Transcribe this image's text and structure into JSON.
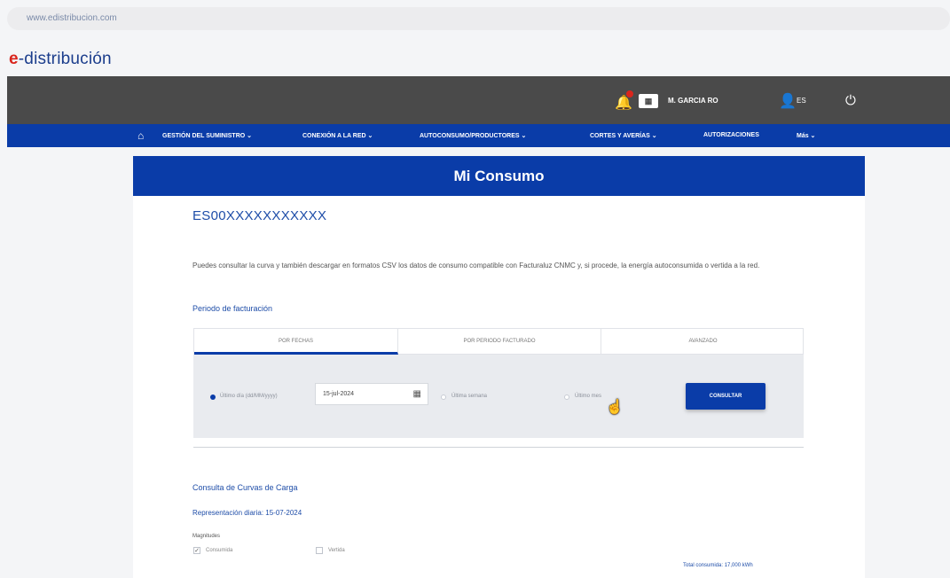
{
  "browser": {
    "url": "www.edistribucion.com"
  },
  "logo": {
    "prefix": "e",
    "text": "-distribución"
  },
  "topbar": {
    "user_name": "M. GARCIA RO",
    "lang": "ES",
    "icons": [
      "bell-icon",
      "id-card-icon",
      "person-icon",
      "power-icon"
    ]
  },
  "nav": {
    "items": [
      "GESTIÓN DEL SUMINISTRO ⌄",
      "CONEXIÓN A LA RED ⌄",
      "AUTOCONSUMO/PRODUCTORES ⌄",
      "CORTES Y AVERÍAS ⌄",
      "AUTORIZACIONES",
      "Más ⌄"
    ]
  },
  "page": {
    "title": "Mi Consumo",
    "cups": "ES00XXXXXXXXXXX",
    "description": "Puedes consultar la curva y también descargar en formatos CSV los datos de consumo compatible con Facturaluz CNMC y, si procede, la energía autoconsumida o vertida a la red.",
    "period_label": "Periodo de facturación"
  },
  "tabs": [
    {
      "label": "POR FECHAS",
      "active": true
    },
    {
      "label": "POR PERIODO FACTURADO",
      "active": false
    },
    {
      "label": "AVANZADO",
      "active": false
    }
  ],
  "filter": {
    "option_day": "Último día (dd/MM/yyyy)",
    "date_value": "15-jul-2024",
    "option_week": "Última semana",
    "option_month": "Último mes",
    "button": "CONSULTAR"
  },
  "results": {
    "section_title": "Consulta de Curvas de Carga",
    "daily_label": "Representación diaria: 15-07-2024",
    "magnitudes_label": "Magnitudes",
    "check_consumida": "Consumida",
    "check_vertida": "Vertida",
    "total": "Total consumida: 17,000 kWh"
  },
  "colors": {
    "brand_blue": "#0a3ca8",
    "topbar": "#4a4a4a",
    "logo_red": "#d9251c"
  }
}
